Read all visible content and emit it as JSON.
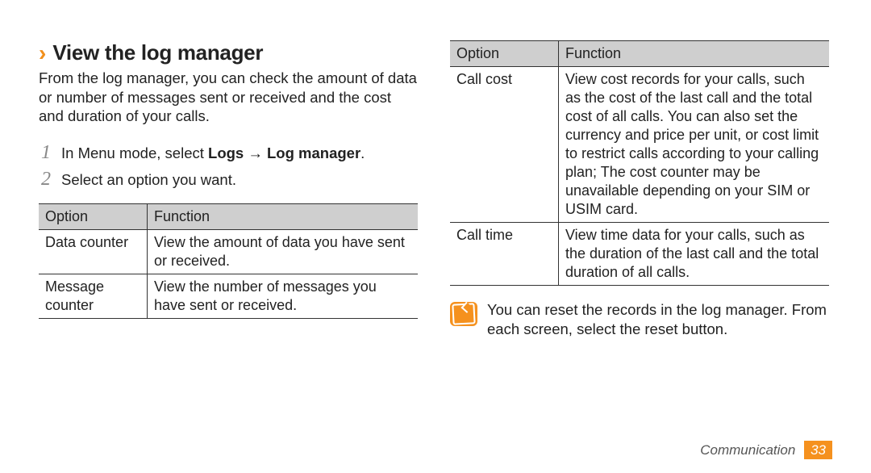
{
  "heading": "View the log manager",
  "intro": "From the log manager, you can check the amount of data or number of messages sent or received and the cost and duration of your calls.",
  "step1_prefix": "In Menu mode, select ",
  "step1_bold": "Logs → Log manager",
  "step1_suffix": ".",
  "step2": "Select an option you want.",
  "table_head_option": "Option",
  "table_head_function": "Function",
  "t1": {
    "r1_opt": "Data counter",
    "r1_fn": "View the amount of data you have sent or received.",
    "r2_opt": "Message counter",
    "r2_fn": "View the number of messages you have sent or received."
  },
  "t2": {
    "r1_opt": "Call cost",
    "r1_fn": "View cost records for your calls, such as the cost of the last call and the total cost of all calls. You can also set the currency and price per unit, or cost limit to restrict calls according to your calling plan; The cost counter may be unavailable depending on your SIM or USIM card.",
    "r2_opt": "Call time",
    "r2_fn": "View time data for your calls, such as the duration of the last call and the total duration of all calls."
  },
  "note": "You can reset the records in the log manager. From each screen, select the reset button.",
  "footer_label": "Communication",
  "footer_page": "33"
}
